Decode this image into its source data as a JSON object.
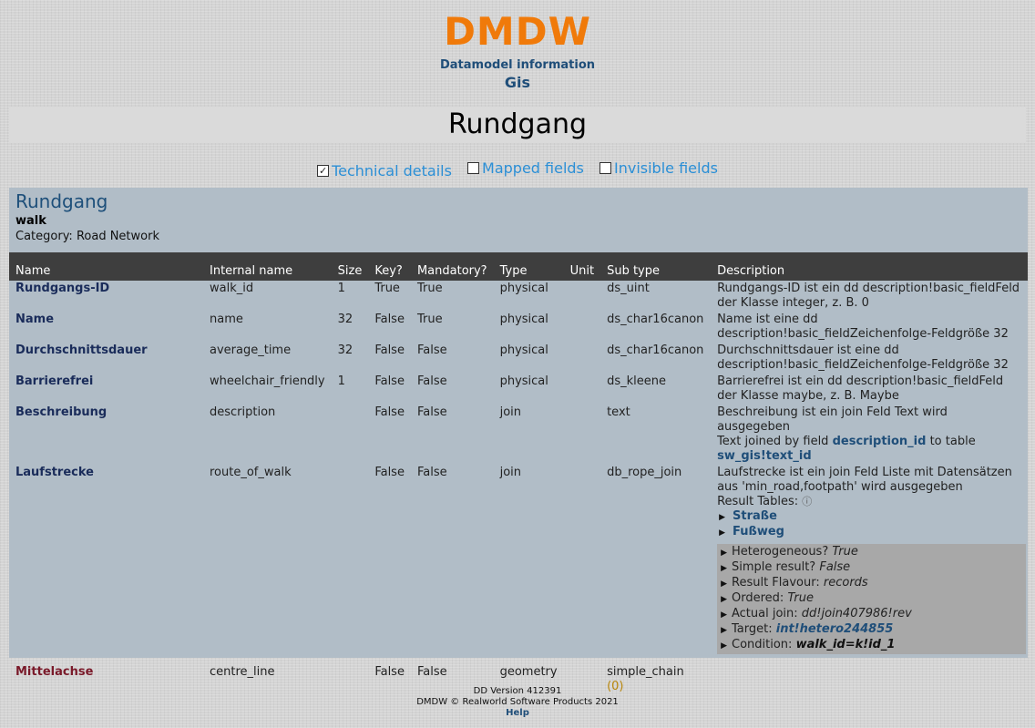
{
  "header": {
    "logo": "DMDW",
    "subtitle": "Datamodel information",
    "model": "Gis"
  },
  "page_title": "Rundgang",
  "options": [
    {
      "label": "Technical details",
      "checked": true
    },
    {
      "label": "Mapped fields",
      "checked": false
    },
    {
      "label": "Invisible fields",
      "checked": false
    }
  ],
  "entity": {
    "title": "Rundgang",
    "internal": "walk",
    "category": "Category: Road Network"
  },
  "columns": [
    "Name",
    "Internal name",
    "Size",
    "Key?",
    "Mandatory?",
    "Type",
    "Unit",
    "Sub type",
    "Description"
  ],
  "rows": [
    {
      "name": "Rundgangs-ID",
      "internal": "walk_id",
      "size": "1",
      "key": "True",
      "mandatory": "True",
      "type": "physical",
      "unit": "",
      "subtype": "ds_uint",
      "description": "Rundgangs-ID ist ein dd description!basic_fieldFeld der Klasse integer, z. B. 0"
    },
    {
      "name": "Name",
      "internal": "name",
      "size": "32",
      "key": "False",
      "mandatory": "True",
      "type": "physical",
      "unit": "",
      "subtype": "ds_char16canon",
      "description": "Name ist eine dd description!basic_fieldZeichenfolge-Feldgröße 32"
    },
    {
      "name": "Durchschnittsdauer",
      "internal": "average_time",
      "size": "32",
      "key": "False",
      "mandatory": "False",
      "type": "physical",
      "unit": "",
      "subtype": "ds_char16canon",
      "description": "Durchschnittsdauer ist eine dd description!basic_fieldZeichenfolge-Feldgröße 32"
    },
    {
      "name": "Barrierefrei",
      "internal": "wheelchair_friendly",
      "size": "1",
      "key": "False",
      "mandatory": "False",
      "type": "physical",
      "unit": "",
      "subtype": "ds_kleene",
      "description": "Barrierefrei ist ein dd description!basic_fieldFeld der Klasse maybe, z. B. Maybe"
    }
  ],
  "beschreibung": {
    "name": "Beschreibung",
    "internal": "description",
    "size": "",
    "key": "False",
    "mandatory": "False",
    "type": "join",
    "unit": "",
    "subtype": "text",
    "description": "Beschreibung ist ein join Feld Text wird ausgegeben",
    "joined_prefix": "Text joined by field",
    "joined_field": "description_id",
    "joined_mid": "to table",
    "joined_table": "sw_gis!text_id"
  },
  "laufstrecke": {
    "name": "Laufstrecke",
    "internal": "route_of_walk",
    "size": "",
    "key": "False",
    "mandatory": "False",
    "type": "join",
    "unit": "",
    "subtype": "db_rope_join",
    "description": "Laufstrecke ist ein join Feld Liste mit Datensätzen aus 'min_road,footpath' wird ausgegeben",
    "result_tables_label": "Result Tables:",
    "result_tables": [
      "Straße",
      "Fußweg"
    ],
    "details": {
      "heterogeneous_label": "Heterogeneous?",
      "heterogeneous": "True",
      "simple_label": "Simple result?",
      "simple": "False",
      "flavour_label": "Result Flavour:",
      "flavour": "records",
      "ordered_label": "Ordered:",
      "ordered": "True",
      "actual_label": "Actual join:",
      "actual": "dd!join407986!rev",
      "target_label": "Target:",
      "target": "int!hetero244855",
      "condition_label": "Condition:",
      "condition": "walk_id=k!id_1"
    }
  },
  "mittelachse": {
    "name": "Mittelachse",
    "internal": "centre_line",
    "size": "",
    "key": "False",
    "mandatory": "False",
    "type": "geometry",
    "unit": "",
    "subtype": "simple_chain",
    "count": "(0)"
  },
  "footer": {
    "version": "DD Version 412391",
    "copyright": "DMDW © Realworld Software Products 2021",
    "help": "Help"
  },
  "colors": {
    "logo": "#f07a0a",
    "accent_blue": "#1f4e79",
    "link_blue": "#2b8fd6",
    "panel_bg": "#b1bdc7",
    "header_row": "#3e3e3e",
    "geometry_name": "#7a1a2a"
  }
}
